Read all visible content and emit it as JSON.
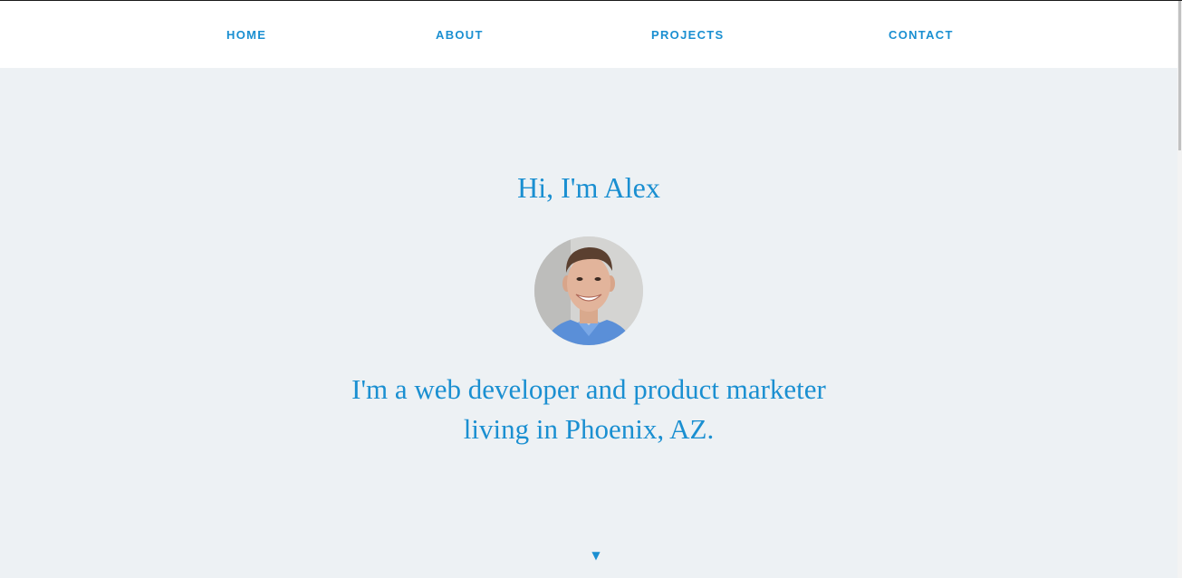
{
  "nav": {
    "items": [
      {
        "label": "HOME"
      },
      {
        "label": "ABOUT"
      },
      {
        "label": "PROJECTS"
      },
      {
        "label": "CONTACT"
      }
    ]
  },
  "hero": {
    "greeting": "Hi, I'm Alex",
    "tagline_line1": "I'm a web developer and product marketer",
    "tagline_line2": "living in Phoenix, AZ.",
    "scroll_arrow": "▼"
  },
  "colors": {
    "accent": "#1a8fd1",
    "background": "#edf1f4",
    "nav_background": "#ffffff"
  }
}
